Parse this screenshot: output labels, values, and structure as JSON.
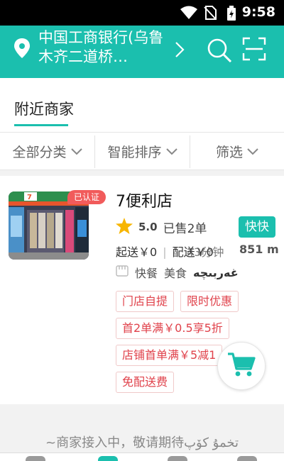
{
  "status_bar": {
    "time": "9:58"
  },
  "header": {
    "address": "中国工商银行(乌鲁木齐二道桥…",
    "accent": "#1bbfae"
  },
  "section_tab": {
    "label": "附近商家"
  },
  "filters": [
    {
      "label": "全部分类"
    },
    {
      "label": "智能排序"
    },
    {
      "label": "筛选"
    }
  ],
  "store": {
    "verified_badge": "已认证",
    "name": "7便利店",
    "score": "5.0",
    "sold": "已售2单",
    "quick_badge": "快快",
    "min_order": "起送￥0",
    "delivery_fee": "配送￥0",
    "delivery_time": "43分钟",
    "distance": "851 m",
    "categories": [
      "快餐",
      "美食"
    ],
    "categories_uyghur": "غەربىچە",
    "tags": [
      [
        "门店自提",
        "限时优惠"
      ],
      [
        "首2单满￥0.5享5折"
      ],
      [
        "店铺首单满￥5减1"
      ],
      [
        "免配送费"
      ]
    ]
  },
  "footer_note": "~商家接入中，敬请期待تخمۇ كۆپ"
}
